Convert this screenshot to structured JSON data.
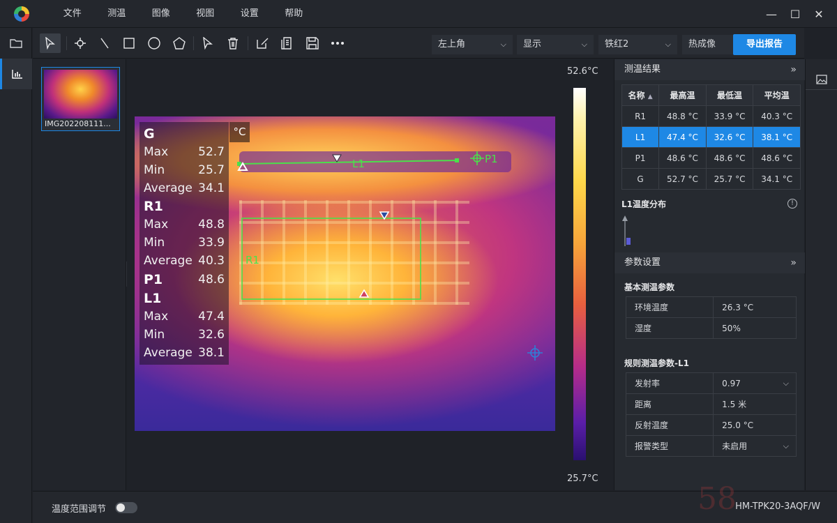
{
  "menu": [
    "文件",
    "测温",
    "图像",
    "视图",
    "设置",
    "帮助"
  ],
  "toolbar": {
    "position_select": "左上角",
    "display_select": "显示",
    "palette_select": "铁红2",
    "mode_select": "热成像",
    "export_label": "导出报告"
  },
  "thumbnail": {
    "name": "IMG202208111..."
  },
  "overlay": {
    "unit": "°C",
    "G": {
      "label": "G",
      "max_label": "Max",
      "max": "52.7",
      "min_label": "Min",
      "min": "25.7",
      "avg_label": "Average",
      "avg": "34.1"
    },
    "R1": {
      "label": "R1",
      "max_label": "Max",
      "max": "48.8",
      "min_label": "Min",
      "min": "33.9",
      "avg_label": "Average",
      "avg": "40.3"
    },
    "P1": {
      "label": "P1",
      "value": "48.6"
    },
    "L1": {
      "label": "L1",
      "max_label": "Max",
      "max": "47.4",
      "min_label": "Min",
      "min": "32.6",
      "avg_label": "Average",
      "avg": "38.1"
    }
  },
  "markers": {
    "line": "L1",
    "point": "P1",
    "rect": "R1"
  },
  "scale": {
    "max": "52.6°C",
    "min": "25.7°C"
  },
  "results": {
    "title": "测温结果",
    "headers": [
      "名称",
      "最高温",
      "最低温",
      "平均温"
    ],
    "rows": [
      [
        "R1",
        "48.8 °C",
        "33.9 °C",
        "40.3 °C"
      ],
      [
        "L1",
        "47.4 °C",
        "32.6 °C",
        "38.1 °C"
      ],
      [
        "P1",
        "48.6 °C",
        "48.6 °C",
        "48.6 °C"
      ],
      [
        "G",
        "52.7 °C",
        "25.7 °C",
        "34.1 °C"
      ]
    ],
    "selected_row": 1
  },
  "distribution": {
    "title": "L1温度分布"
  },
  "params": {
    "title": "参数设置",
    "basic_title": "基本测温参数",
    "basic": [
      {
        "label": "环境温度",
        "value": "26.3 °C"
      },
      {
        "label": "湿度",
        "value": "50%"
      }
    ],
    "rule_title": "规则测温参数-L1",
    "rule": [
      {
        "label": "发射率",
        "value": "0.97"
      },
      {
        "label": "距离",
        "value": "1.5 米"
      },
      {
        "label": "反射温度",
        "value": "25.0 °C"
      },
      {
        "label": "报警类型",
        "value": "未启用"
      }
    ]
  },
  "status": {
    "range_label": "温度范围调节",
    "model": "HM-TPK20-3AQF/W"
  },
  "watermark": "58"
}
